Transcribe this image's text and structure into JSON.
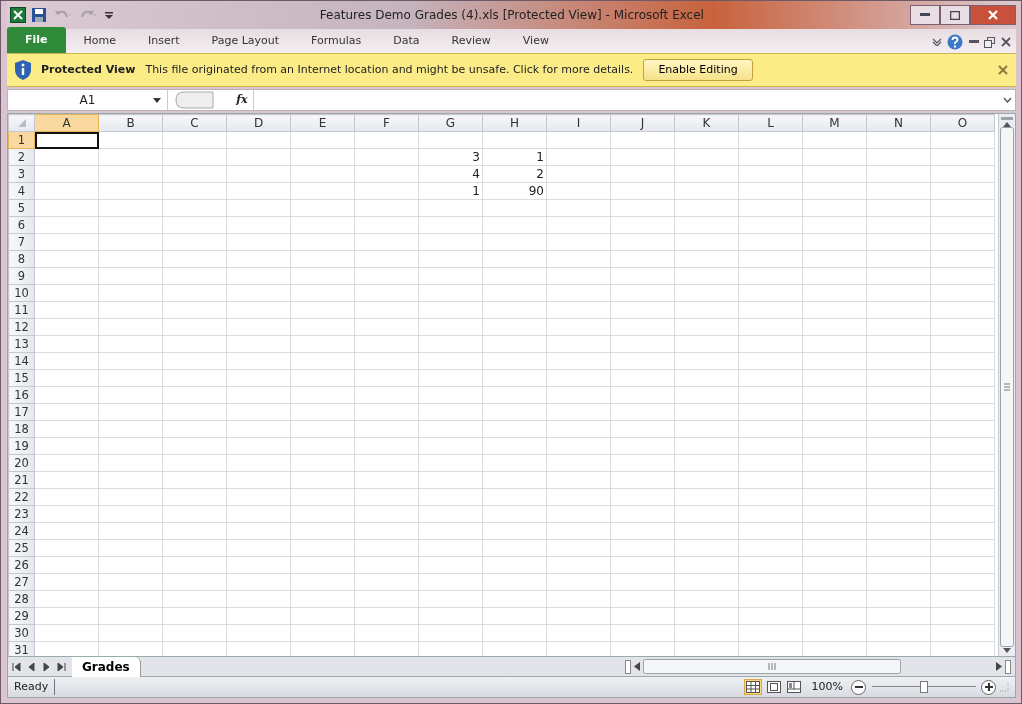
{
  "window": {
    "title": "Features Demo Grades (4).xls  [Protected View]  -  Microsoft Excel"
  },
  "ribbon_tabs": [
    {
      "label": "File",
      "kind": "file",
      "selected": false
    },
    {
      "label": "Home",
      "kind": "tab",
      "selected": false
    },
    {
      "label": "Insert",
      "kind": "tab",
      "selected": false
    },
    {
      "label": "Page Layout",
      "kind": "tab",
      "selected": false
    },
    {
      "label": "Formulas",
      "kind": "tab",
      "selected": false
    },
    {
      "label": "Data",
      "kind": "tab",
      "selected": false
    },
    {
      "label": "Review",
      "kind": "tab",
      "selected": false
    },
    {
      "label": "View",
      "kind": "tab",
      "selected": false
    }
  ],
  "protected_view": {
    "title": "Protected View",
    "message": "This file originated from an Internet location and might be unsafe. Click for more details.",
    "button": "Enable Editing"
  },
  "formula_bar": {
    "name_box": "A1",
    "fx": "fx"
  },
  "columns": [
    {
      "label": "A",
      "selected": true
    },
    {
      "label": "B",
      "selected": false
    },
    {
      "label": "C",
      "selected": false
    },
    {
      "label": "D",
      "selected": false
    },
    {
      "label": "E",
      "selected": false
    },
    {
      "label": "F",
      "selected": false
    },
    {
      "label": "G",
      "selected": false
    },
    {
      "label": "H",
      "selected": false
    },
    {
      "label": "I",
      "selected": false
    },
    {
      "label": "J",
      "selected": false
    },
    {
      "label": "K",
      "selected": false
    },
    {
      "label": "L",
      "selected": false
    },
    {
      "label": "M",
      "selected": false
    },
    {
      "label": "N",
      "selected": false
    },
    {
      "label": "O",
      "selected": false
    }
  ],
  "rows": [
    {
      "label": "1",
      "selected": true,
      "cells": []
    },
    {
      "label": "2",
      "selected": false,
      "cells": [
        null,
        null,
        null,
        null,
        null,
        null,
        "3",
        "1"
      ]
    },
    {
      "label": "3",
      "selected": false,
      "cells": [
        null,
        null,
        null,
        null,
        null,
        null,
        "4",
        "2"
      ]
    },
    {
      "label": "4",
      "selected": false,
      "cells": [
        null,
        null,
        null,
        null,
        null,
        null,
        "1",
        "90"
      ]
    },
    {
      "label": "5",
      "selected": false,
      "cells": []
    },
    {
      "label": "6",
      "selected": false,
      "cells": []
    },
    {
      "label": "7",
      "selected": false,
      "cells": []
    },
    {
      "label": "8",
      "selected": false,
      "cells": []
    },
    {
      "label": "9",
      "selected": false,
      "cells": []
    },
    {
      "label": "10",
      "selected": false,
      "cells": []
    },
    {
      "label": "11",
      "selected": false,
      "cells": []
    },
    {
      "label": "12",
      "selected": false,
      "cells": []
    },
    {
      "label": "13",
      "selected": false,
      "cells": []
    },
    {
      "label": "14",
      "selected": false,
      "cells": []
    },
    {
      "label": "15",
      "selected": false,
      "cells": []
    },
    {
      "label": "16",
      "selected": false,
      "cells": []
    },
    {
      "label": "17",
      "selected": false,
      "cells": []
    },
    {
      "label": "18",
      "selected": false,
      "cells": []
    },
    {
      "label": "19",
      "selected": false,
      "cells": []
    },
    {
      "label": "20",
      "selected": false,
      "cells": []
    },
    {
      "label": "21",
      "selected": false,
      "cells": []
    },
    {
      "label": "22",
      "selected": false,
      "cells": []
    },
    {
      "label": "23",
      "selected": false,
      "cells": []
    },
    {
      "label": "24",
      "selected": false,
      "cells": []
    },
    {
      "label": "25",
      "selected": false,
      "cells": []
    },
    {
      "label": "26",
      "selected": false,
      "cells": []
    },
    {
      "label": "27",
      "selected": false,
      "cells": []
    },
    {
      "label": "28",
      "selected": false,
      "cells": []
    },
    {
      "label": "29",
      "selected": false,
      "cells": []
    },
    {
      "label": "30",
      "selected": false,
      "cells": []
    },
    {
      "label": "31",
      "selected": false,
      "cells": []
    }
  ],
  "sheet_tabs": [
    {
      "label": "Grades",
      "selected": true
    }
  ],
  "status_bar": {
    "status": "Ready",
    "views": [
      {
        "kind": "normal",
        "selected": true
      },
      {
        "kind": "page-layout",
        "selected": false
      },
      {
        "kind": "page-break",
        "selected": false
      }
    ],
    "zoom": "100%",
    "zoom_slider": {
      "level": 0.5
    }
  }
}
